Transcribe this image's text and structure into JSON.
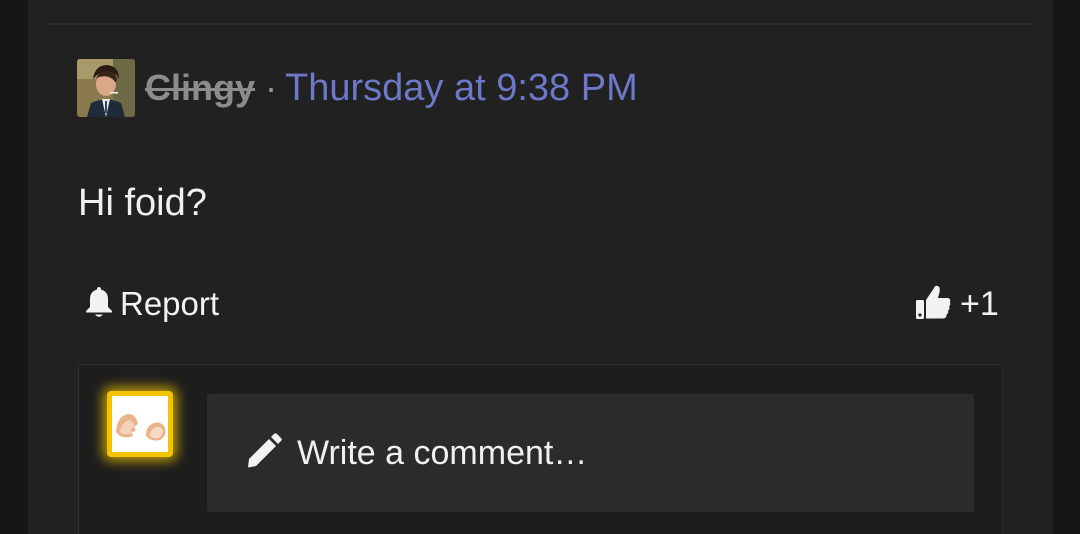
{
  "post": {
    "author": {
      "username": "Clingy",
      "username_struck": true
    },
    "separator": "·",
    "timestamp": "Thursday at 9:38 PM",
    "body": "Hi foid?",
    "actions": {
      "report_label": "Report",
      "report_icon": "bell-icon",
      "like_icon": "thumbs-up-icon",
      "like_count": "+1"
    }
  },
  "comment_composer": {
    "placeholder": "Write a comment…",
    "icon": "pencil-icon",
    "avatar_icon": "cracked-egg-icon"
  },
  "colors": {
    "background": "#212121",
    "link": "#6c78c8",
    "text": "#f0f0f0",
    "muted_username": "#8c8c8c",
    "avatar_highlight": "#f5c400",
    "input_background": "#2b2b2b"
  }
}
